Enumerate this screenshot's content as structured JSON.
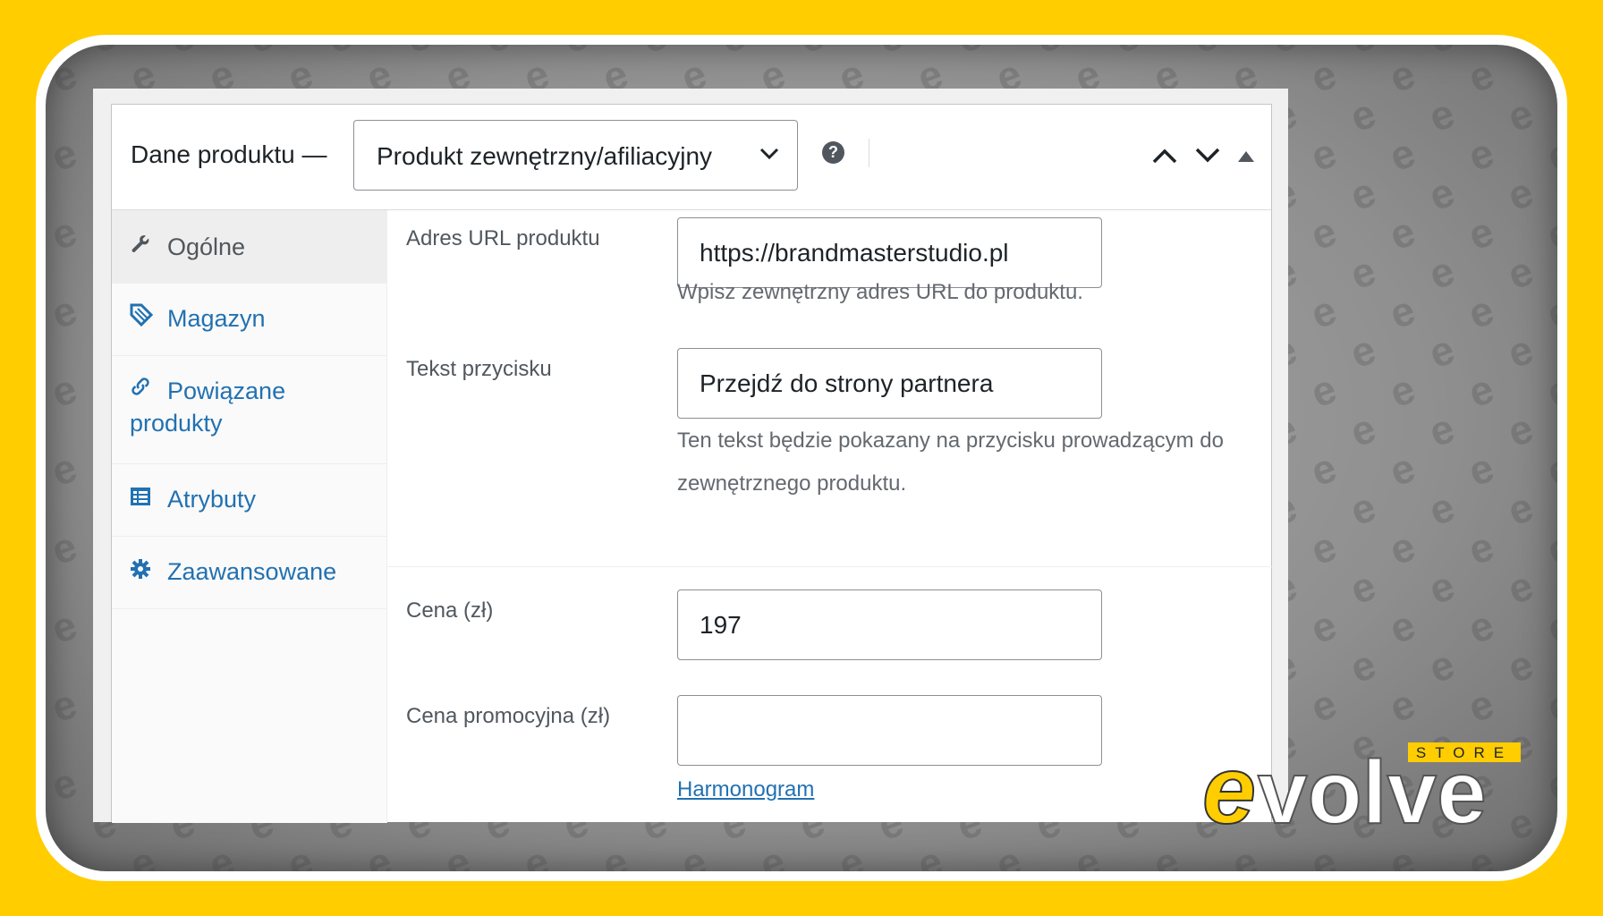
{
  "header": {
    "title": "Dane produktu —",
    "product_type": {
      "selected": "Produkt zewnętrzny/afiliacyjny",
      "icon": "chevron-down-icon"
    },
    "help_icon": "question-circle-icon",
    "help_glyph": "?"
  },
  "tabs": [
    {
      "label": "Ogólne",
      "icon": "wrench-icon",
      "active": true
    },
    {
      "label": "Magazyn",
      "icon": "tag-icon",
      "active": false
    },
    {
      "label": "Powiązane",
      "label_line2": "produkty",
      "icon": "link-icon",
      "active": false
    },
    {
      "label": "Atrybuty",
      "icon": "list-table-icon",
      "active": false
    },
    {
      "label": "Zaawansowane",
      "icon": "gear-icon",
      "active": false
    }
  ],
  "fields": {
    "product_url": {
      "label": "Adres URL produktu",
      "value": "https://brandmasterstudio.pl",
      "description": "Wpisz zewnętrzny adres URL do produktu."
    },
    "button_text": {
      "label": "Tekst przycisku",
      "value": "Przejdź do strony partnera",
      "description_line1": "Ten tekst będzie pokazany na przycisku prowadzącym do",
      "description_line2": "zewnętrznego produktu."
    },
    "price": {
      "label": "Cena (zł)",
      "value": "197"
    },
    "sale_price": {
      "label": "Cena promocyjna (zł)",
      "value": "",
      "schedule_link": "Harmonogram"
    }
  },
  "branding": {
    "logo_word": "evolve",
    "logo_tag": "STORE",
    "accent": "#FFCD00",
    "link_color": "#2271b1"
  }
}
